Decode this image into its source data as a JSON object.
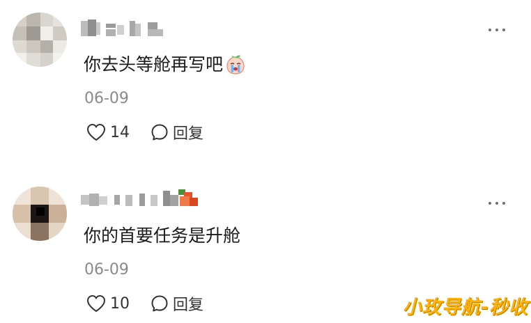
{
  "comments": [
    {
      "text": "你去头等舱再写吧",
      "emoji": "crying-peach-emoji",
      "date": "06-09",
      "likes": "14",
      "reply_label": "回复"
    },
    {
      "text": "你的首要任务是升舱",
      "date": "06-09",
      "likes": "10",
      "reply_label": "回复"
    }
  ],
  "watermark": "小玫导航-秒收",
  "colors": {
    "text": "#1a1a1a",
    "meta": "#8a8a8a",
    "watermark": "#ffb300"
  }
}
